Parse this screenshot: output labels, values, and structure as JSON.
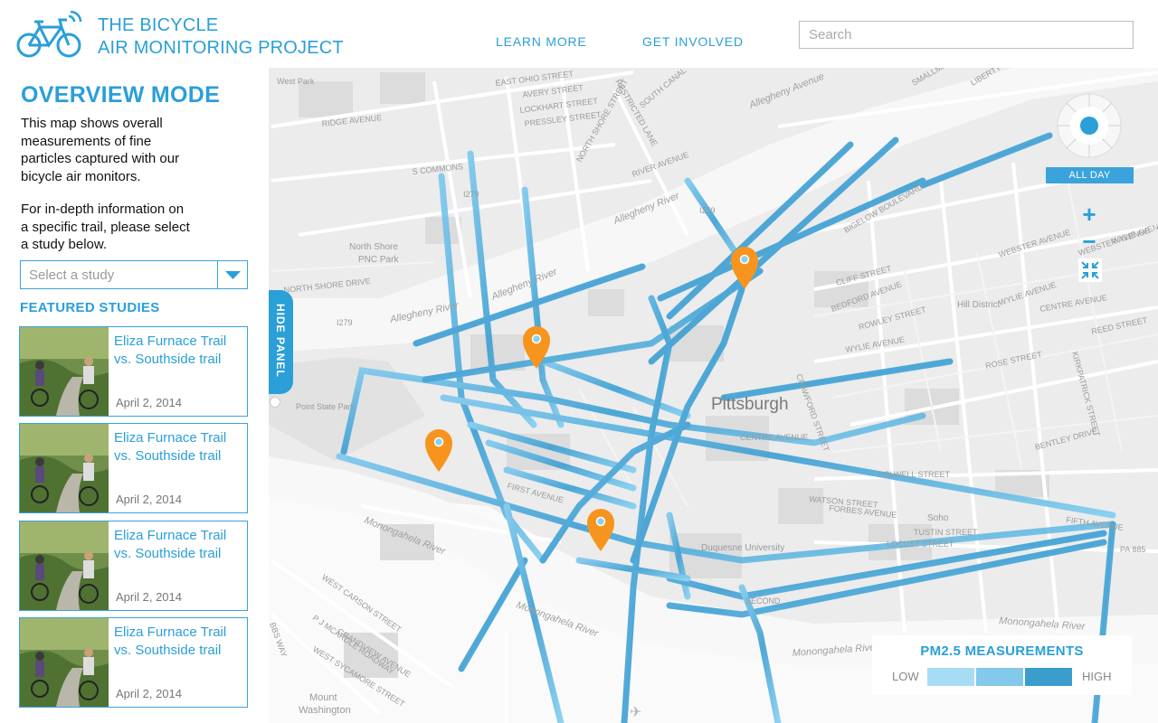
{
  "header": {
    "title_line1": "THE BICYCLE",
    "title_line2": "AIR MONITORING PROJECT",
    "nav": {
      "learn_more": "LEARN MORE",
      "get_involved": "GET INVOLVED"
    },
    "search_placeholder": "Search",
    "brand_color": "#2a9fd8"
  },
  "sidebar": {
    "mode_title": "OVERVIEW MODE",
    "description": [
      "This map shows overall",
      "measurements of fine",
      "particles captured with our",
      "bicycle air monitors."
    ],
    "instructions": [
      "For in-depth information on",
      "a specific trail, please select",
      "a study below."
    ],
    "select": {
      "value": "Select a study"
    },
    "featured_title": "FEATURED STUDIES",
    "studies": [
      {
        "title_line1": "Eliza Furnace Trail",
        "title_line2": "vs. Southside trail",
        "date": "April 2, 2014"
      },
      {
        "title_line1": "Eliza Furnace Trail",
        "title_line2": "vs. Southside trail",
        "date": "April 2, 2014"
      },
      {
        "title_line1": "Eliza Furnace Trail",
        "title_line2": "vs. Southside trail",
        "date": "April 2, 2014"
      },
      {
        "title_line1": "Eliza Furnace Trail",
        "title_line2": "vs. Southside trail",
        "date": "April 2, 2014"
      }
    ]
  },
  "map": {
    "hide_panel": "HIDE PANEL",
    "time_filter": "ALL DAY",
    "zoom_in": "+",
    "zoom_out": "−",
    "labels": {
      "pittsburgh": "Pittsburgh",
      "allegheny_river_1": "Allegheny River",
      "allegheny_river_2": "Allegheny River",
      "allegheny_river_3": "Allegheny River",
      "monongahela_1": "Monongahela River",
      "monongahela_2": "Monongahela River",
      "monongahela_3": "Monongahela River",
      "monongahela_4": "Monongahela River",
      "north_shore": "North Shore",
      "pnc_park": "PNC Park",
      "point_state": "Point State Park",
      "hill_district": "Hill District",
      "duquesne": "Duquesne University",
      "soho": "Soho",
      "mount_washington_1": "Mount",
      "mount_washington_2": "Washington",
      "west_park": "West Park",
      "i279_1": "I279",
      "i279_2": "I279",
      "i279_3": "I279",
      "pa885": "PA 885",
      "streets": {
        "east_ohio": "EAST OHIO STREET",
        "avery": "AVERY STREET",
        "lockhart": "LOCKHART STREET",
        "pressley": "PRESSLEY STREET",
        "ridge": "RIDGE AVENUE",
        "s_commons": "S COMMONS",
        "north_shore_dr": "NORTH SHORE DRIVE",
        "river_ave": "RIVER AVENUE",
        "bigelow": "BIGELOW BOULEVARD",
        "webster": "WEBSTER AVENUE",
        "webster2": "WEBSTER AVENUE",
        "wylie": "WYLIE AVENUE",
        "wylie2": "WYLIE AVENUE",
        "wylie3": "WYLIE AVENUE",
        "bedford": "BEDFORD AVENUE",
        "centre": "CENTRE AVENUE",
        "centre2": "CENTRE AVENUE",
        "fifth": "FIFTH AVENUE",
        "forbes": "FORBES AVENUE",
        "watson": "WATSON STREET",
        "locust": "LOCUST STREET",
        "tustin": "TUSTIN STREET",
        "colwell": "COLWELL STREET",
        "bentley": "BENTLEY DRIVE",
        "reed": "REED STREET",
        "rose": "ROSE STREET",
        "cliff": "CLIFF STREET",
        "rowley": "ROWLEY STREET",
        "west_carson": "WEST CARSON STREET",
        "pj_mcardle": "P J MCARDLE ROADWAY",
        "grandview": "GRANDVIEW AVENUE",
        "sycamore": "WEST SYCAMORE STREET",
        "smallman": "SMALLMAN",
        "liberty": "LIBERTY",
        "allegheny_ave": "Allegheny Avenue",
        "crawford": "CRAWFORD STREET",
        "kirkpatrick": "KIRKPATRICK STREET",
        "south_canal": "SOUTH CANAL",
        "restricted": "RESTRICTED LANE",
        "north_sixteenth": "NORTH SHORE STREET",
        "first_ave": "FIRST AVENUE",
        "second": "SECOND",
        "bbs_way": "BBS WAY"
      }
    }
  },
  "legend": {
    "title": "PM2.5 MEASUREMENTS",
    "low": "LOW",
    "high": "HIGH",
    "colors": [
      "#a8dcf4",
      "#84c8ea",
      "#5ab1dc",
      "#3a9dcc"
    ]
  },
  "marker_color": "#f7941d",
  "trail_color": "#4fb2e3"
}
